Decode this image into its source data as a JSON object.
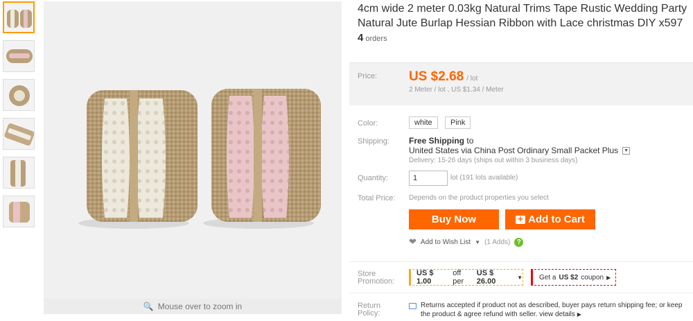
{
  "product": {
    "title": "4cm wide 2 meter 0.03kg Natural Trims Tape Rustic Wedding Party Natural Jute Burlap Hessian Ribbon with Lace christmas DIY x597",
    "orders_count": "4",
    "orders_label": "orders"
  },
  "gallery": {
    "zoom_hint": "Mouse over to zoom in",
    "thumbnail_count": 6
  },
  "price": {
    "label": "Price:",
    "value": "US $2.68",
    "unit": "/ lot",
    "detail": "2 Meter / lot , US $1.34 / Meter"
  },
  "color": {
    "label": "Color:",
    "options": [
      "white",
      "Pink"
    ]
  },
  "shipping": {
    "label": "Shipping:",
    "free": "Free Shipping",
    "to": "to",
    "method": "United States via China Post Ordinary Small Packet Plus",
    "delivery": "Delivery: 15-26 days (ships out within 3 business days)"
  },
  "quantity": {
    "label": "Quantity:",
    "value": "1",
    "available": "lot (191 lots available)"
  },
  "total": {
    "label": "Total Price:",
    "value": "Depends on the product properties you select"
  },
  "actions": {
    "buy_now": "Buy Now",
    "add_to_cart": "Add to Cart",
    "wishlist": "Add to Wish List",
    "wishlist_count": "(1 Adds)"
  },
  "promotion": {
    "label_1": "Store",
    "label_2": "Promotion:",
    "coupon_1_a": "US $ 1.00",
    "coupon_1_b": "off per",
    "coupon_1_c": "US $ 26.00",
    "coupon_2_a": "Get a",
    "coupon_2_b": "US $2",
    "coupon_2_c": "coupon"
  },
  "return_policy": {
    "label_1": "Return",
    "label_2": "Policy:",
    "line_1": "Returns accepted if product not as described, buyer pays return shipping fee; or keep",
    "line_2": "the product & agree refund with seller.",
    "link": "view details"
  },
  "colors": {
    "accent": "#ff6600",
    "burlap": "#b9a07a",
    "lace_white": "#efece2",
    "lace_pink": "#e8c3c6"
  }
}
